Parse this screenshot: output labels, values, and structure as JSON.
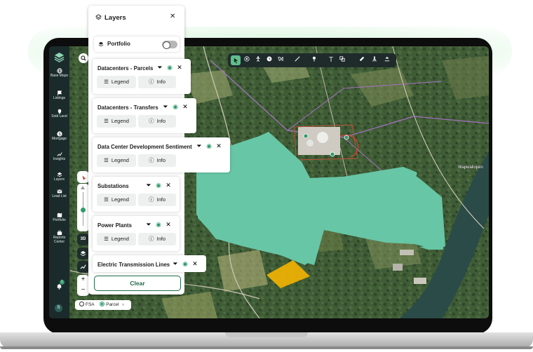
{
  "colors": {
    "brand": "#1f6b49",
    "accent": "#2f9a6a",
    "highlight_polygon": "#67c6a6",
    "parcel": "#f4b400"
  },
  "sidebar": {
    "logo_icon": "layers-logo-icon",
    "items": [
      {
        "label": "Base Maps",
        "icon": "globe-icon"
      },
      {
        "label": "Listings",
        "icon": "flag-icon"
      },
      {
        "label": "Sold Land",
        "icon": "pin-icon"
      },
      {
        "label": "Mortgage",
        "icon": "dollar-icon"
      },
      {
        "label": "Insights",
        "icon": "insights-icon"
      },
      {
        "label": "Layers",
        "icon": "layers-icon"
      },
      {
        "label": "Lead List",
        "icon": "mail-icon"
      },
      {
        "label": "Portfolio",
        "icon": "map-icon"
      },
      {
        "label": "Reports Center",
        "icon": "briefcase-icon"
      }
    ],
    "notifications_count": "1",
    "avatar_initial": "S"
  },
  "map_controls": {
    "threed_label": "3D",
    "zoom_in": "+",
    "zoom_out": "−"
  },
  "toolbar": {
    "tools": [
      "select-icon",
      "target-icon",
      "person-icon",
      "clock-icon",
      "lasso-icon",
      "line-icon",
      "pin-icon",
      "text-icon",
      "shape-icon",
      "ruler-icon",
      "survey-icon",
      "elevation-icon"
    ],
    "text_tool_glyph": "T"
  },
  "layers_panel": {
    "title": "Layers",
    "portfolio_label": "Portfolio",
    "portfolio_enabled": false,
    "legend_label": "Legend",
    "info_label": "Info",
    "layers": [
      {
        "name": "Datacenters - Parcels"
      },
      {
        "name": "Datacenters - Transfers"
      },
      {
        "name": "Data Center Development Sentiment"
      },
      {
        "name": "Substations"
      },
      {
        "name": "Power Plants"
      },
      {
        "name": "Electric Transmission Lines"
      }
    ],
    "clear_label": "Clear"
  },
  "parcel_toggle": {
    "options": [
      "FSA",
      "Parcel"
    ],
    "selected": "Parcel"
  },
  "map_labels": {
    "place": "Wapwallopen"
  }
}
